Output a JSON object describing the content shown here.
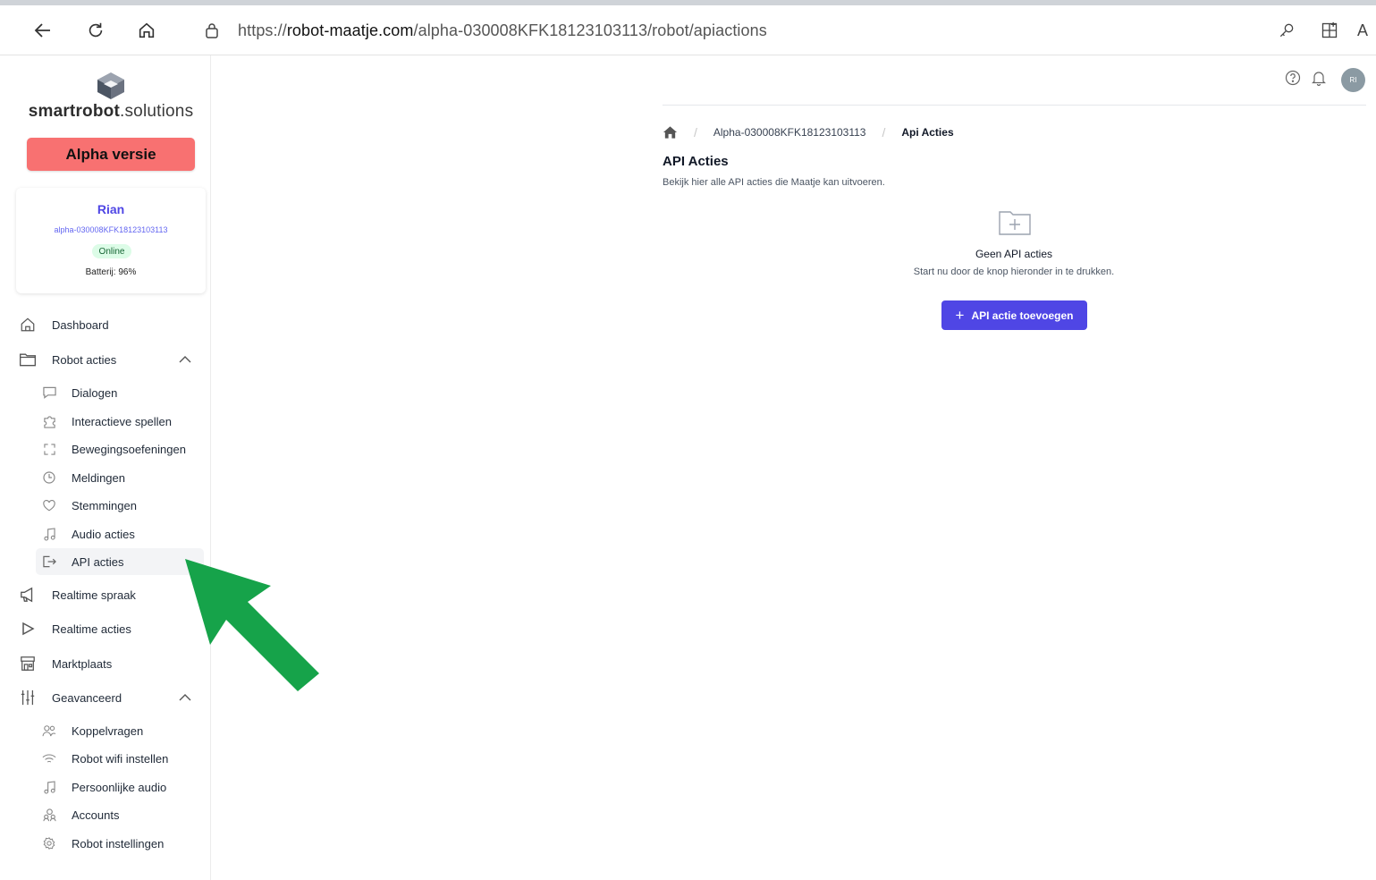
{
  "browser": {
    "url_prefix": "https://",
    "url_domain": "robot-maatje.com",
    "url_path": "/alpha-030008KFK18123103113/robot/apiactions",
    "right_letter": "A"
  },
  "sidebar": {
    "logo_bold": "smartrobot",
    "logo_rest": ".solutions",
    "version_badge": "Alpha versie",
    "robot": {
      "name": "Rian",
      "id": "alpha-030008KFK18123103113",
      "status": "Online",
      "battery": "Batterij: 96%"
    },
    "items": [
      {
        "label": "Dashboard",
        "icon": "home-icon"
      },
      {
        "label": "Robot acties",
        "icon": "folder-icon"
      },
      {
        "label": "Realtime spraak",
        "icon": "megaphone-icon"
      },
      {
        "label": "Realtime acties",
        "icon": "play-icon"
      },
      {
        "label": "Marktplaats",
        "icon": "store-icon"
      },
      {
        "label": "Geavanceerd",
        "icon": "sliders-icon"
      }
    ],
    "robot_acties_sub": [
      {
        "label": "Dialogen",
        "icon": "chat-icon"
      },
      {
        "label": "Interactieve spellen",
        "icon": "puzzle-icon"
      },
      {
        "label": "Bewegingsoefeningen",
        "icon": "expand-icon"
      },
      {
        "label": "Meldingen",
        "icon": "clock-icon"
      },
      {
        "label": "Stemmingen",
        "icon": "heart-icon"
      },
      {
        "label": "Audio acties",
        "icon": "music-icon"
      },
      {
        "label": "API acties",
        "icon": "api-icon"
      }
    ],
    "geavanceerd_sub": [
      {
        "label": "Koppelvragen",
        "icon": "users-icon"
      },
      {
        "label": "Robot wifi instellen",
        "icon": "wifi-icon"
      },
      {
        "label": "Persoonlijke audio",
        "icon": "music-icon"
      },
      {
        "label": "Accounts",
        "icon": "accounts-icon"
      },
      {
        "label": "Robot instellingen",
        "icon": "settings-icon"
      }
    ]
  },
  "header": {
    "avatar_initials": "RI"
  },
  "breadcrumb": {
    "robot": "Alpha-030008KFK18123103113",
    "current": "Api Acties"
  },
  "main": {
    "title": "API Acties",
    "subtitle": "Bekijk hier alle API acties die Maatje kan uitvoeren.",
    "empty_title": "Geen API acties",
    "empty_subtitle": "Start nu door de knop hieronder in te drukken.",
    "add_button": "API actie toevoegen"
  },
  "colors": {
    "accent": "#4f46e5",
    "alpha_badge": "#f87171",
    "online_bg": "#dcfce7",
    "arrow": "#16a34a"
  }
}
